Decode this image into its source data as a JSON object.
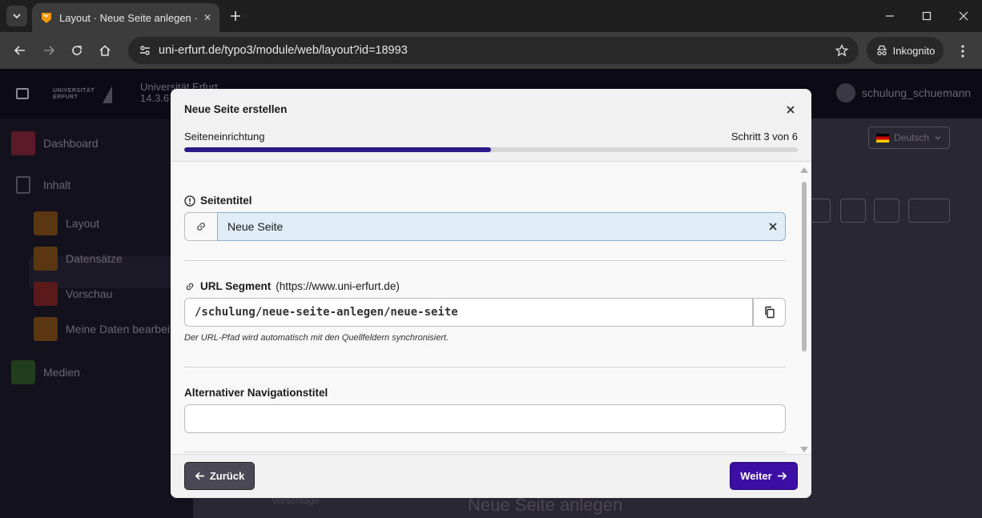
{
  "browser": {
    "tab_title": "Layout · Neue Seite anlegen · Universität Erfurt",
    "url": "uni-erfurt.de/typo3/module/web/layout?id=18993",
    "incognito_label": "Inkognito"
  },
  "app": {
    "logo_text_line1": "UNIVERSITÄT",
    "logo_text_line2": "ERFURT",
    "site_name": "Universität Erfurt",
    "site_version": "14.3.6",
    "username": "schulung_schuemann",
    "language": "Deutsch",
    "sidebar": {
      "dashboard": "Dashboard",
      "inhalt": "Inhalt",
      "layout": "Layout",
      "datensaetze": "Datensätze",
      "vorschau": "Vorschau",
      "meine_daten": "Meine Daten bearbeiten",
      "medien": "Medien"
    },
    "bg_page_title": "Neue Seite anlegen",
    "bg_suggestion": "Vorschläge"
  },
  "modal": {
    "title": "Neue Seite erstellen",
    "step_label": "Seiteneinrichtung",
    "step_count": "Schritt 3 von 6",
    "progress_fraction": 0.5,
    "fields": {
      "page_title_label": "Seitentitel",
      "page_title_value": "Neue Seite",
      "url_segment_label": "URL Segment",
      "url_segment_base": "(https://www.uni-erfurt.de)",
      "url_segment_value": "/schulung/neue-seite-anlegen/neue-seite",
      "url_help": "Der URL-Pfad wird automatisch mit den Quellfeldern synchronisiert.",
      "nav_title_label": "Alternativer Navigationstitel",
      "nav_title_value": ""
    },
    "buttons": {
      "back": "Zurück",
      "next": "Weiter"
    }
  }
}
